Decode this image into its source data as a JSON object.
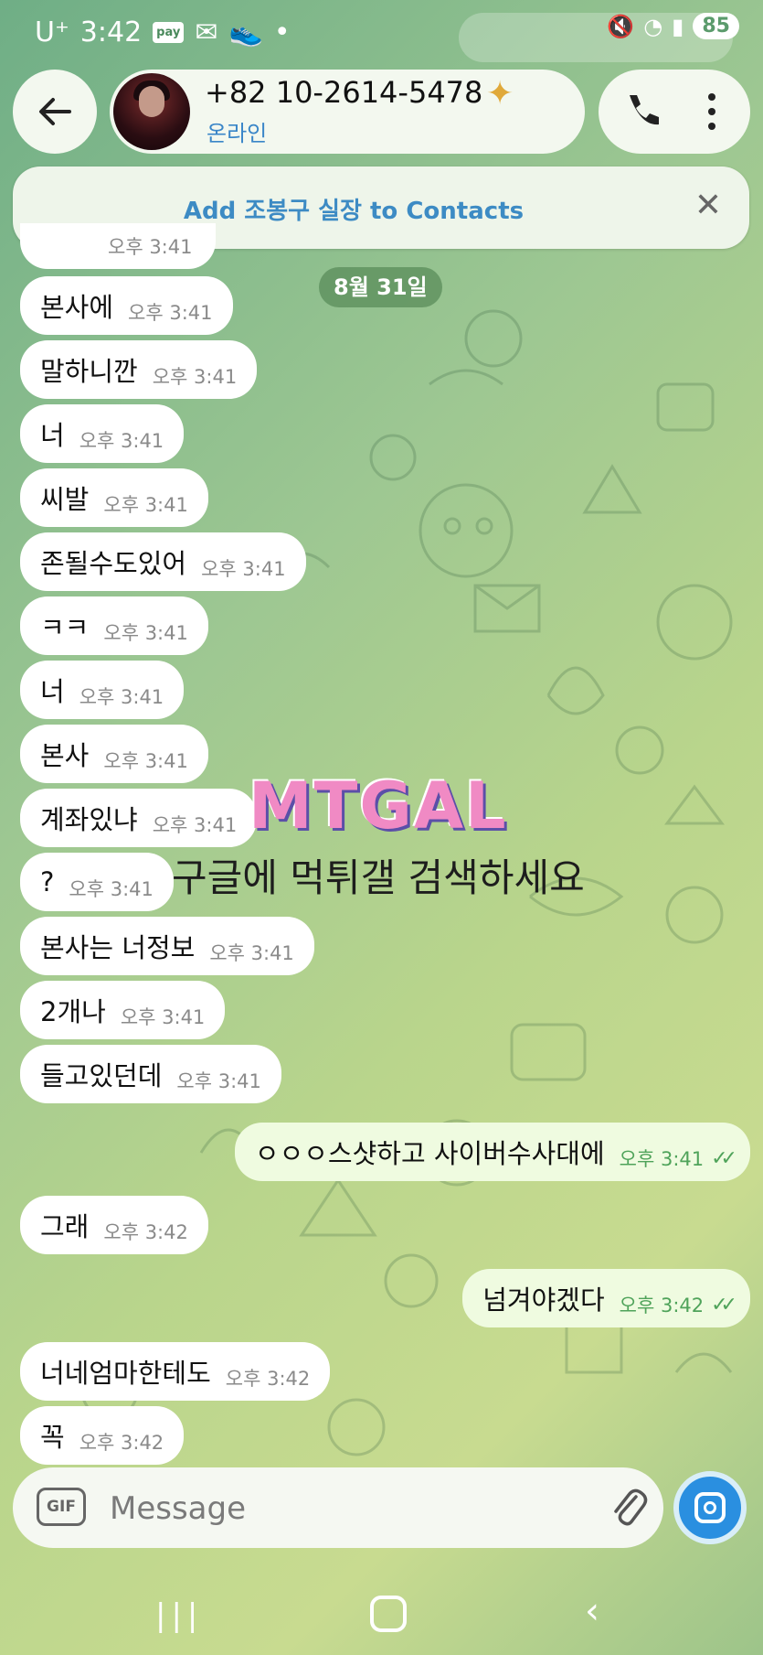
{
  "status_bar": {
    "carrier": "U⁺",
    "time": "3:42",
    "pay_badge": "pay",
    "battery": "85",
    "icons": [
      "muted-icon",
      "wifi-icon",
      "signal-icon"
    ]
  },
  "header": {
    "contact_number": "+82 10-2614-5478",
    "status": "온라인",
    "star": "✦"
  },
  "banner": {
    "text": "Add 조봉구 실장 to Contacts",
    "close": "✕"
  },
  "date_separator": "8월 31일",
  "messages": [
    {
      "text": "본사에",
      "time": "오후 3:41",
      "dir": "in"
    },
    {
      "text": "말하니깐",
      "time": "오후 3:41",
      "dir": "in"
    },
    {
      "text": "너",
      "time": "오후 3:41",
      "dir": "in"
    },
    {
      "text": "씨발",
      "time": "오후 3:41",
      "dir": "in"
    },
    {
      "text": "존될수도있어",
      "time": "오후 3:41",
      "dir": "in"
    },
    {
      "text": "ㅋㅋ",
      "time": "오후 3:41",
      "dir": "in"
    },
    {
      "text": "너",
      "time": "오후 3:41",
      "dir": "in"
    },
    {
      "text": "본사",
      "time": "오후 3:41",
      "dir": "in"
    },
    {
      "text": "계좌있냐",
      "time": "오후 3:41",
      "dir": "in"
    },
    {
      "text": "?",
      "time": "오후 3:41",
      "dir": "in"
    },
    {
      "text": "본사는 너정보",
      "time": "오후 3:41",
      "dir": "in"
    },
    {
      "text": "2개나",
      "time": "오후 3:41",
      "dir": "in"
    },
    {
      "text": "들고있던데",
      "time": "오후 3:41",
      "dir": "in"
    },
    {
      "text": "ㅇㅇㅇ스샷하고 사이버수사대에",
      "time": "오후 3:41",
      "dir": "out"
    },
    {
      "text": "그래",
      "time": "오후 3:42",
      "dir": "in"
    },
    {
      "text": "넘겨야겠다",
      "time": "오후 3:42",
      "dir": "out"
    },
    {
      "text": "너네엄마한테도",
      "time": "오후 3:42",
      "dir": "in"
    },
    {
      "text": "꼭",
      "time": "오후 3:42",
      "dir": "in"
    }
  ],
  "partial_message_time": "오후 3:41",
  "watermark": {
    "logo": "MTGAL",
    "text": "구글에 먹튀갤 검색하세요"
  },
  "composer": {
    "gif_label": "GIF",
    "placeholder": "Message"
  },
  "nav": {
    "recents": "|||",
    "back": "‹"
  }
}
